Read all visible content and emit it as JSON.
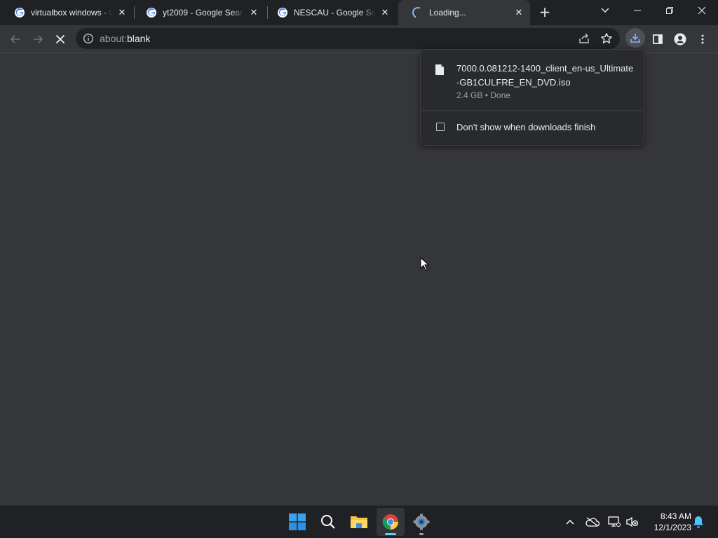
{
  "tabs": [
    {
      "title": "virtualbox windows - G",
      "favicon": "google-g-icon",
      "close": "✕"
    },
    {
      "title": "yt2009 - Google Searc",
      "favicon": "google-g-icon",
      "close": "✕"
    },
    {
      "title": "NESCAU - Google Sea",
      "favicon": "google-g-icon",
      "close": "✕"
    },
    {
      "title": "Loading...",
      "favicon": "loading-spinner-icon",
      "close": "✕"
    }
  ],
  "new_tab_label": "+",
  "omnibox": {
    "scheme": "about:",
    "rest": "blank"
  },
  "download": {
    "filename": "7000.0.081212-1400_client_en-us_Ultimate-GB1CULFRE_EN_DVD.iso",
    "size": "2.4 GB",
    "separator": " • ",
    "status": "Done",
    "checkbox_label": "Don't show when downloads finish",
    "checkbox_checked": false
  },
  "clock": {
    "time": "8:43 AM",
    "date": "12/1/2023"
  },
  "colors": {
    "accent": "#8ab4f8",
    "taskbar_accent": "#60cdff",
    "surface": "#35363a",
    "frame": "#202124"
  }
}
